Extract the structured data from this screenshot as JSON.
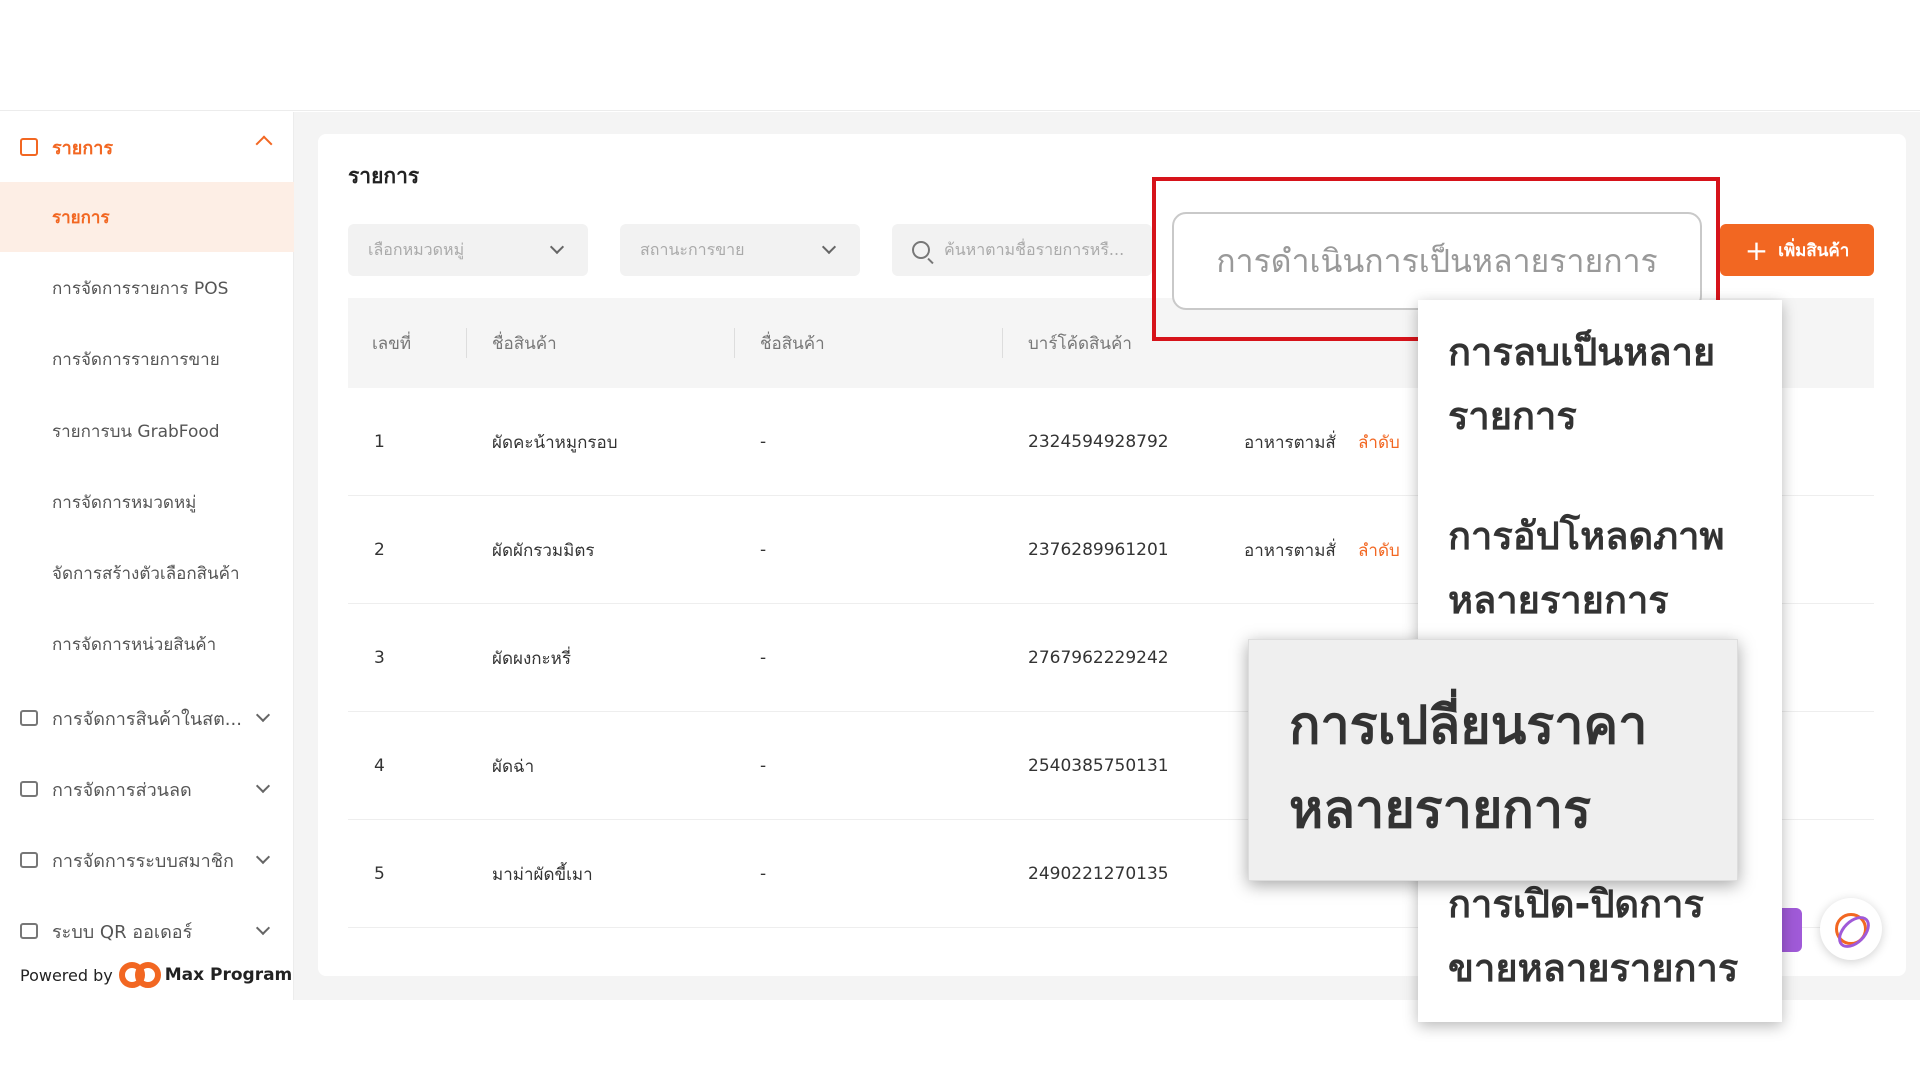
{
  "sidebar": {
    "section_title": "รายการ",
    "items": [
      {
        "label": "รายการ",
        "active": true
      },
      {
        "label": "การจัดการรายการ POS"
      },
      {
        "label": "การจัดการรายการขาย"
      },
      {
        "label": "รายการบน GrabFood"
      },
      {
        "label": "การจัดการหมวดหมู่"
      },
      {
        "label": "จัดการสร้างตัวเลือกสินค้า"
      },
      {
        "label": "การจัดการหน่วยสินค้า"
      }
    ],
    "groups": [
      {
        "label": "การจัดการสินค้าในสต...",
        "icon": "warehouse-icon"
      },
      {
        "label": "การจัดการส่วนลด",
        "icon": "coupon-icon"
      },
      {
        "label": "การจัดการระบบสมาชิก",
        "icon": "member-icon"
      },
      {
        "label": "ระบบ QR ออเดอร์",
        "icon": "cloche-icon"
      }
    ],
    "powered_by": "Powered by",
    "brand": "Max Program"
  },
  "main": {
    "title": "รายการ",
    "filters": {
      "category_placeholder": "เลือกหมวดหมู่",
      "status_placeholder": "สถานะการขาย",
      "search_placeholder": "ค้นหาตามชื่อรายการหรื..."
    },
    "bulk_button": "การดำเนินการเป็นหลายรายการ",
    "add_button": "เพิ่มสินค้า",
    "table": {
      "headers": [
        "เลขที่",
        "ชื่อสินค้า",
        "ชื่อสินค้า",
        "บาร์โค้ดสินค้า"
      ],
      "rows": [
        {
          "no": "1",
          "name": "ผัดคะน้าหมูกรอบ",
          "name2": "-",
          "barcode": "2324594928792",
          "category": "อาหารตามสั่ง",
          "action": "ลำดับ"
        },
        {
          "no": "2",
          "name": "ผัดผักรวมมิตร",
          "name2": "-",
          "barcode": "2376289961201",
          "category": "อาหารตามสั่ง",
          "action": "ลำดับ"
        },
        {
          "no": "3",
          "name": "ผัดผงกะหรี่",
          "name2": "-",
          "barcode": "2767962229242",
          "category": "",
          "action": ""
        },
        {
          "no": "4",
          "name": "ผัดฉ่า",
          "name2": "-",
          "barcode": "2540385750131",
          "category": "",
          "action": ""
        },
        {
          "no": "5",
          "name": "มาม่าผัดขี้เมา",
          "name2": "-",
          "barcode": "2490221270135",
          "category": "",
          "action": ""
        }
      ]
    }
  },
  "bulk_menu": {
    "items": [
      "การลบเป็นหลายรายการ",
      "การอัปโหลดภาพหลายรายการ",
      "การเปลี่ยนราคาหลายรายการ",
      "การเปิด-ปิดการขายหลายรายการ"
    ]
  },
  "colors": {
    "accent": "#f26722",
    "highlight": "#d6131a"
  }
}
